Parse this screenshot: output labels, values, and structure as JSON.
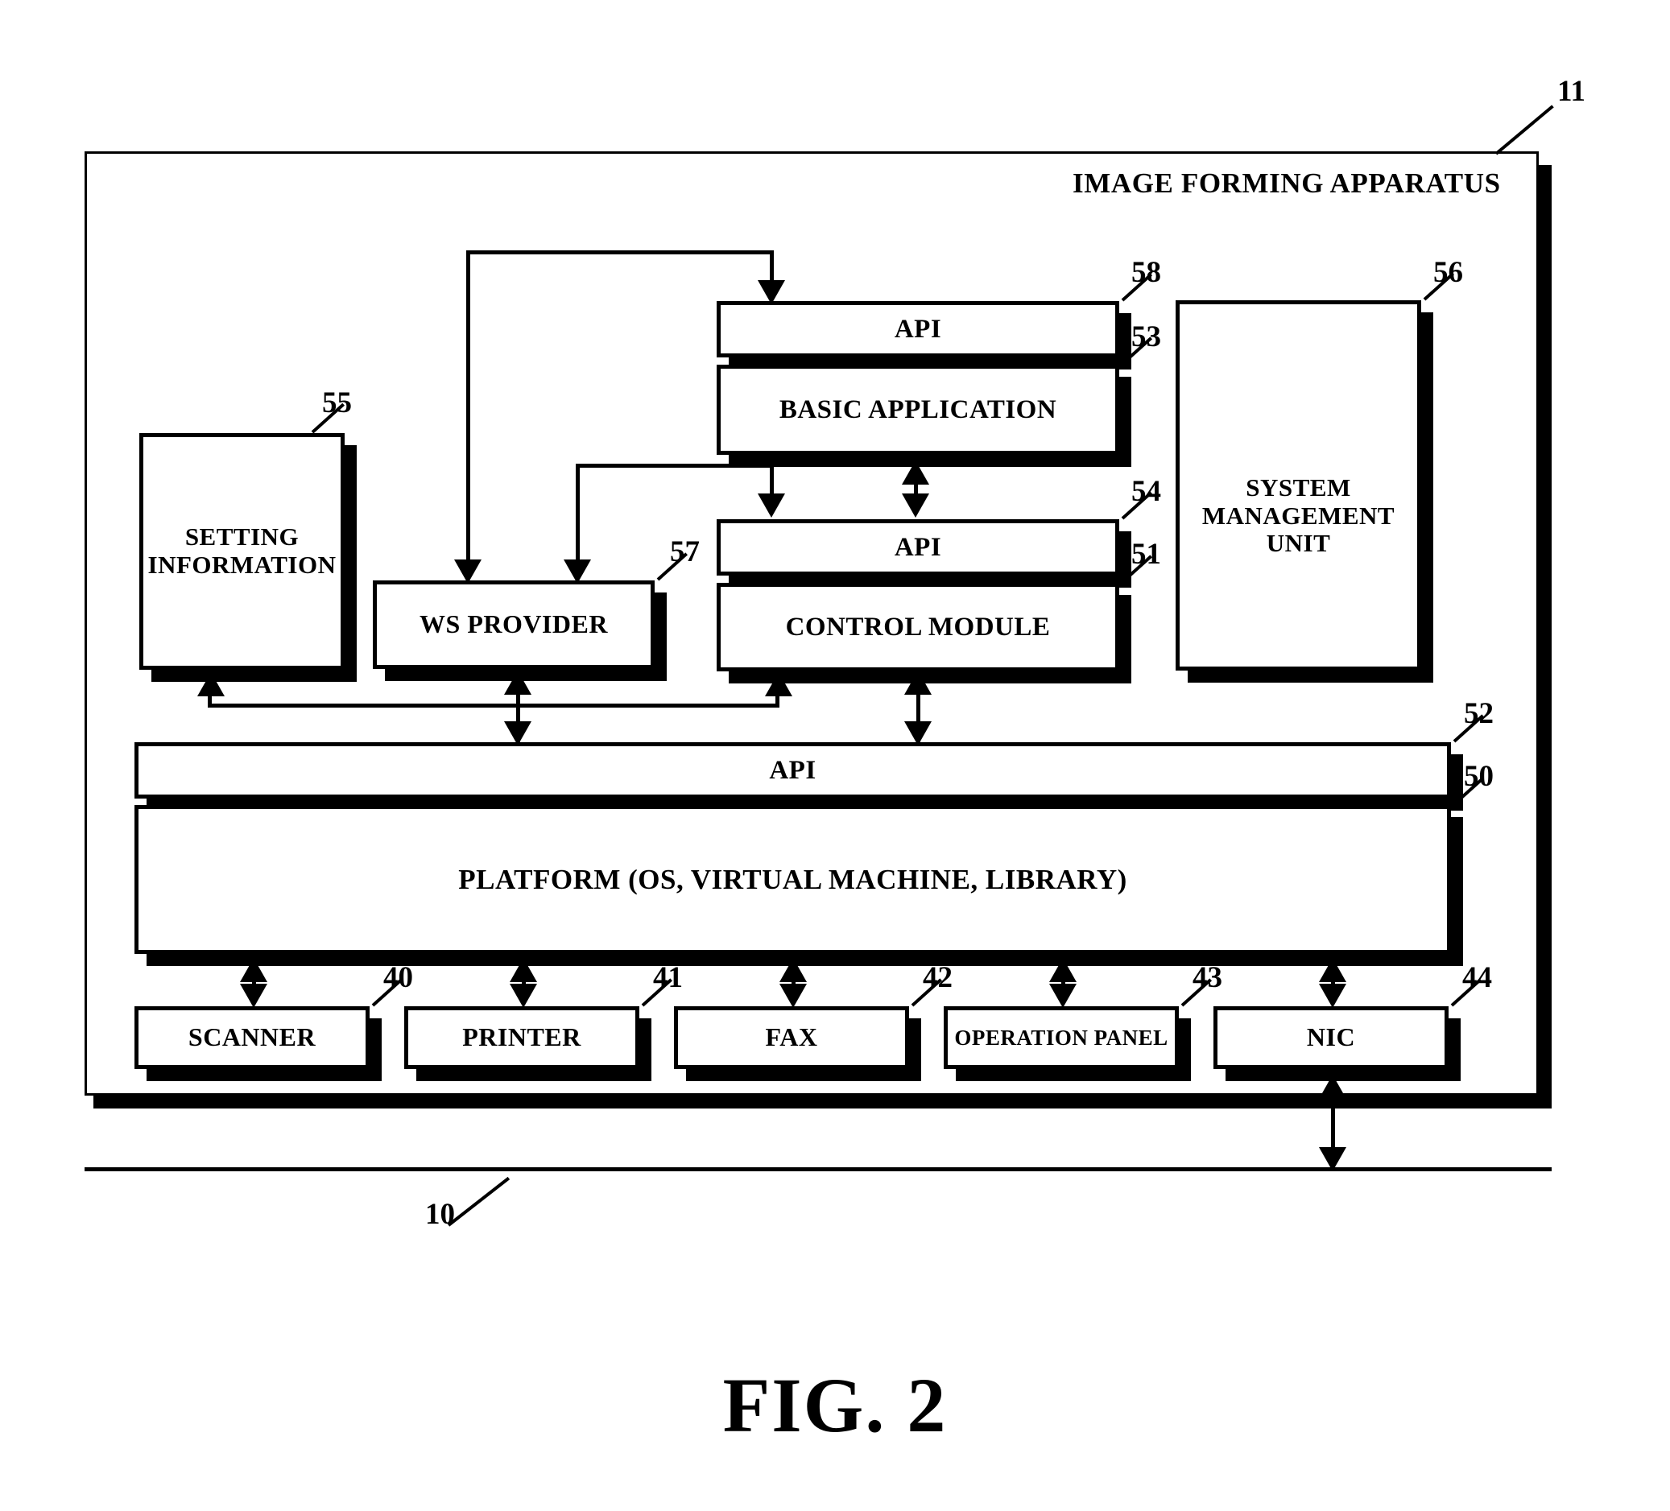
{
  "figure": {
    "caption": "FIG. 2",
    "apparatus_label": "IMAGE FORMING APPARATUS",
    "apparatus_ref": "11",
    "network_ref": "10"
  },
  "blocks": {
    "api_top": {
      "label": "API",
      "ref": "58"
    },
    "basic_application": {
      "label": "BASIC APPLICATION",
      "ref": "53"
    },
    "api_mid": {
      "label": "API",
      "ref": "54"
    },
    "control_module": {
      "label": "CONTROL MODULE",
      "ref": "51"
    },
    "system_management_unit": {
      "label": "SYSTEM\nMANAGEMENT\nUNIT",
      "line1": "SYSTEM",
      "line2": "MANAGEMENT",
      "line3": "UNIT",
      "ref": "56"
    },
    "setting_information": {
      "label": "SETTING\nINFORMATION",
      "line1": "SETTING",
      "line2": "INFORMATION",
      "ref": "55"
    },
    "ws_provider": {
      "label": "WS PROVIDER",
      "ref": "57"
    },
    "api_platform": {
      "label": "API",
      "ref": "52"
    },
    "platform": {
      "label": "PLATFORM (OS, VIRTUAL MACHINE, LIBRARY)",
      "ref": "50"
    }
  },
  "devices": [
    {
      "label": "SCANNER",
      "ref": "40"
    },
    {
      "label": "PRINTER",
      "ref": "41"
    },
    {
      "label": "FAX",
      "ref": "42"
    },
    {
      "label": "OPERATION PANEL",
      "ref": "43"
    },
    {
      "label": "NIC",
      "ref": "44"
    }
  ],
  "colors": {
    "ink": "#000000",
    "paper": "#ffffff"
  }
}
